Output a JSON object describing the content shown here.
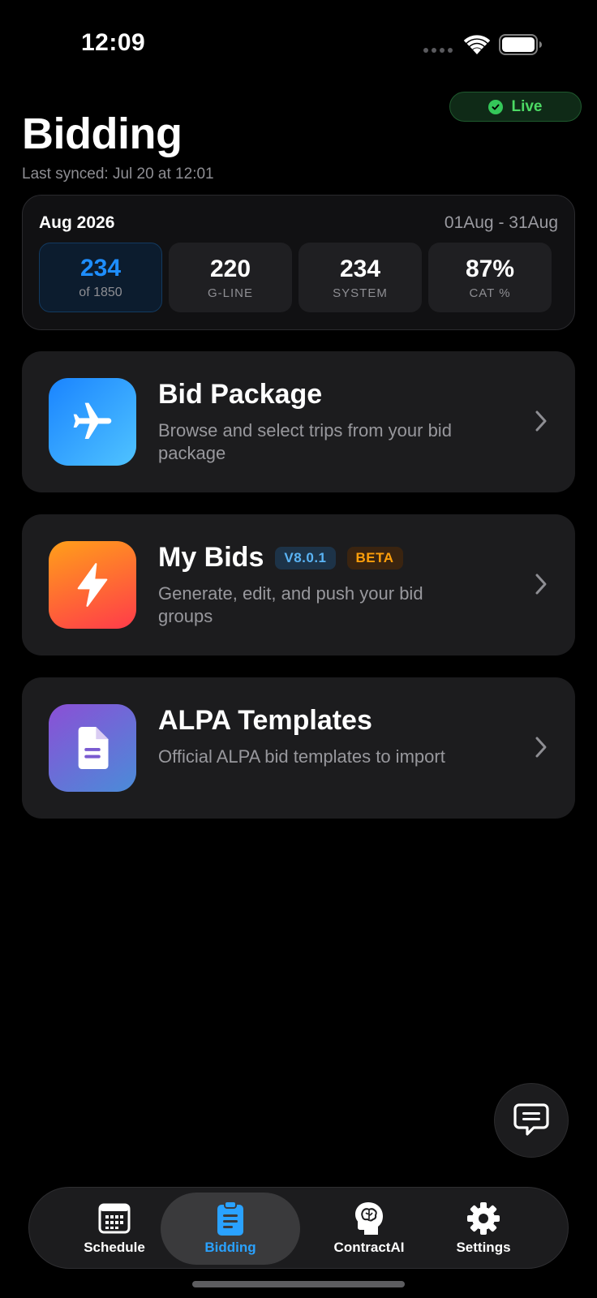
{
  "status_bar": {
    "time": "12:09"
  },
  "header": {
    "live_label": "Live",
    "title": "Bidding",
    "last_synced": "Last synced: Jul 20 at 12:01"
  },
  "stats": {
    "month": "Aug 2026",
    "range": "01Aug - 31Aug",
    "tiles": [
      {
        "value": "234",
        "sub": "of 1850"
      },
      {
        "value": "220",
        "sub": "G-LINE"
      },
      {
        "value": "234",
        "sub": "SYSTEM"
      },
      {
        "value": "87%",
        "sub": "CAT %"
      }
    ]
  },
  "cards": [
    {
      "title": "Bid Package",
      "desc": "Browse and select trips from your bid package",
      "icon": "airplane-icon"
    },
    {
      "title": "My Bids",
      "version_badge": "V8.0.1",
      "beta_badge": "BETA",
      "desc": "Generate, edit, and push your bid groups",
      "icon": "lightning-icon"
    },
    {
      "title": "ALPA Templates",
      "desc": "Official ALPA bid templates to import",
      "icon": "document-icon"
    }
  ],
  "tabs": [
    {
      "label": "Schedule",
      "icon": "calendar-icon"
    },
    {
      "label": "Bidding",
      "icon": "clipboard-icon",
      "active": true
    },
    {
      "label": "ContractAI",
      "icon": "brain-head-icon"
    },
    {
      "label": "Settings",
      "icon": "gear-icon"
    }
  ],
  "colors": {
    "accent": "#1e8eff",
    "live": "#34c759",
    "beta": "#ff9f0a"
  }
}
